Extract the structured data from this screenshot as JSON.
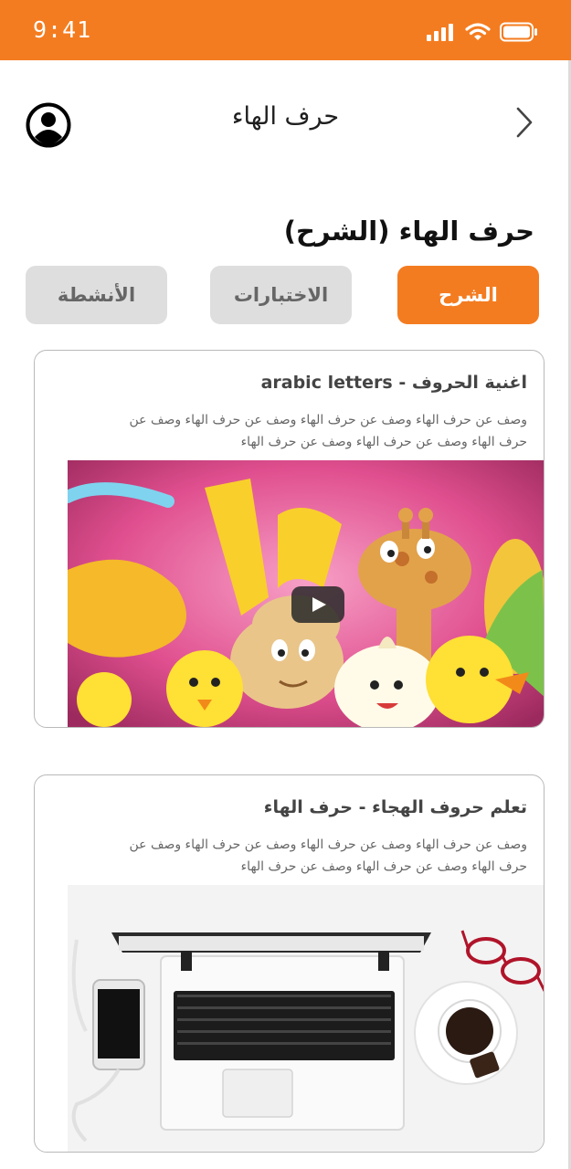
{
  "status_bar": {
    "time": "9:41"
  },
  "header": {
    "title": "حرف الهاء"
  },
  "section": {
    "title": "حرف الهاء  (الشرح)"
  },
  "tabs": [
    {
      "label": "الشرح",
      "active": true
    },
    {
      "label": "الاختبارات",
      "active": false
    },
    {
      "label": "الأنشطة",
      "active": false
    }
  ],
  "cards": [
    {
      "title": "اغنية الحروف - arabic letters",
      "description": "وصف عن حرف الهاء وصف عن حرف الهاء وصف عن حرف الهاء وصف عن حرف الهاء وصف عن حرف الهاء وصف عن حرف الهاء",
      "media": "video-thumbnail"
    },
    {
      "title": "تعلم حروف الهجاء - حرف الهاء",
      "description": "وصف عن حرف الهاء وصف عن حرف الهاء وصف عن حرف الهاء وصف عن حرف الهاء وصف عن حرف الهاء وصف عن حرف الهاء",
      "media": "laptop-desk-photo"
    }
  ],
  "icons": {
    "avatar": "user-circle-icon",
    "back": "chevron-right-icon",
    "signal": "cellular-signal-icon",
    "wifi": "wifi-icon",
    "battery": "battery-icon",
    "play": "play-icon"
  },
  "colors": {
    "accent": "#f47c20",
    "tab_inactive": "#dedede",
    "card_border": "#b9b9b9"
  }
}
